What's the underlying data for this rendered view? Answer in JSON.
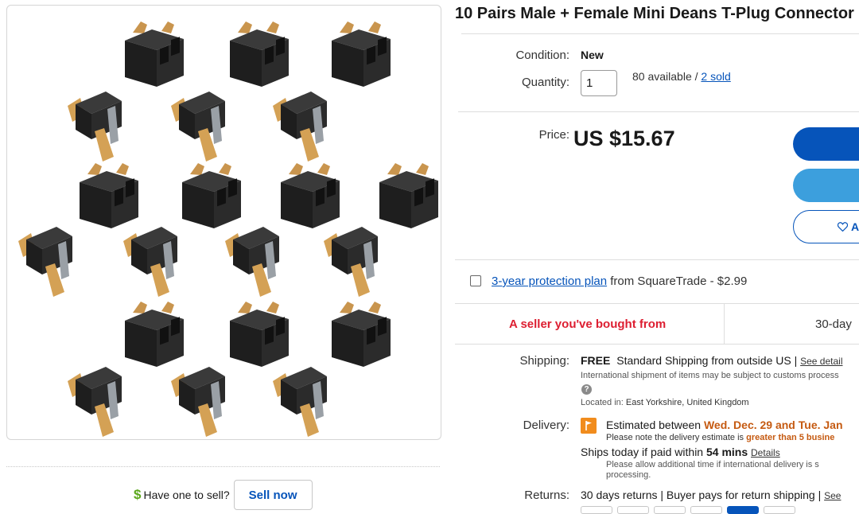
{
  "product": {
    "title": "10 Pairs Male + Female Mini Deans T-Plug Connector"
  },
  "image": {
    "alt_subject": "connector-grid-image"
  },
  "sell": {
    "prompt": "Have one to sell?",
    "button_label": "Sell now"
  },
  "condition": {
    "label": "Condition:",
    "value": "New"
  },
  "quantity": {
    "label": "Quantity:",
    "value": "1",
    "available": "80 available /",
    "sold_link": "2 sold"
  },
  "price": {
    "label": "Price:",
    "value": "US $15.67"
  },
  "actions": {
    "watch_label": "A"
  },
  "protection": {
    "link": "3-year protection plan",
    "rest": "from SquareTrade - $2.99"
  },
  "seller_badges": {
    "seller": "A seller you've bought from",
    "returns": "30-day"
  },
  "shipping": {
    "label": "Shipping:",
    "free": "FREE",
    "method": "Standard Shipping from outside US |",
    "details_link": "See detail",
    "note": "International shipment of items may be subject to customs process",
    "info_icon": "?",
    "located_label": "Located in:",
    "located_value": "East Yorkshire, United Kingdom"
  },
  "delivery": {
    "label": "Delivery:",
    "estimate_prefix": "Estimated between",
    "estimate_dates": "Wed. Dec. 29 and Tue. Jan",
    "note_prefix": "Please note the delivery estimate is",
    "note_bold": "greater than 5 busine",
    "ships_prefix": "Ships today if paid within",
    "ships_mins": "54 mins",
    "ships_details": "Details",
    "allow_note": "Please allow additional time if international delivery is s processing."
  },
  "returns": {
    "label": "Returns:",
    "text": "30 days returns | Buyer pays for return shipping |",
    "see_link": "See"
  },
  "colors": {
    "primary_blue": "#0654ba",
    "secondary_blue": "#3c9fdd",
    "seller_red": "#dd1e31",
    "delivery_orange": "#c55a11",
    "sell_green": "#5ba71b"
  }
}
